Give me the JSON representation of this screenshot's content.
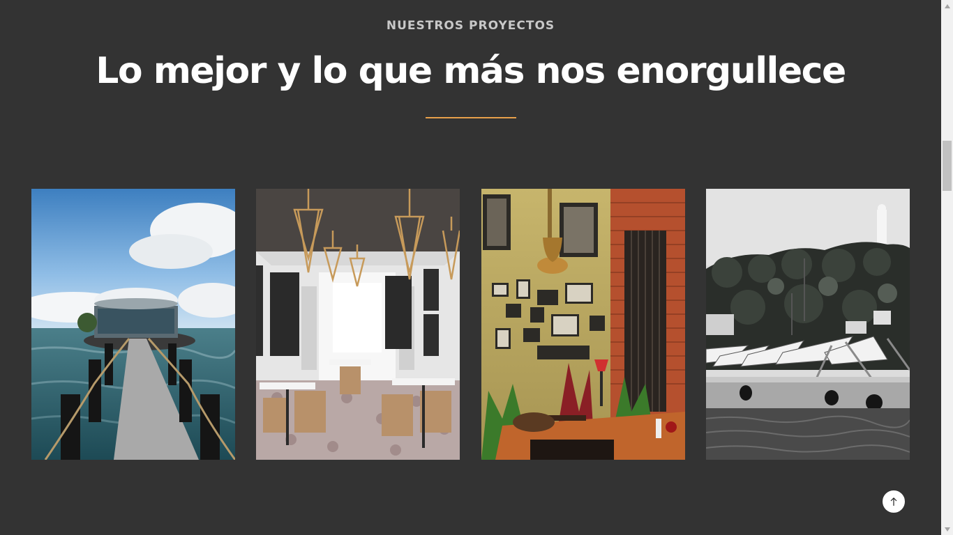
{
  "section": {
    "eyebrow": "NUESTROS PROYECTOS",
    "title": "Lo mejor y lo que más nos enorgullece"
  },
  "colors": {
    "background": "#333333",
    "accent": "#e8a04a",
    "text": "#ffffff",
    "eyebrow": "#c8c8c8"
  },
  "projects": [
    {
      "name": "project-card-pier",
      "icon": "pier-photo"
    },
    {
      "name": "project-card-restaurant",
      "icon": "restaurant-interior-photo"
    },
    {
      "name": "project-card-bar",
      "icon": "bar-interior-photo"
    },
    {
      "name": "project-card-waterfront",
      "icon": "waterfront-photo"
    }
  ],
  "back_to_top": {
    "icon": "arrow-up-icon"
  }
}
